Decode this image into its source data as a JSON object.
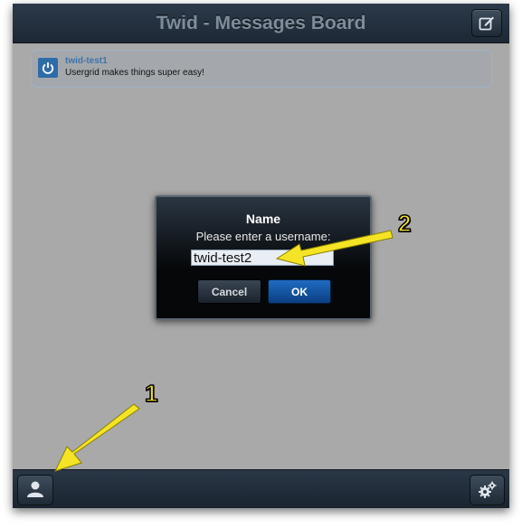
{
  "header": {
    "title": "Twid - Messages Board",
    "compose_icon": "compose-icon"
  },
  "messages": [
    {
      "username": "twid-test1",
      "text": "Usergrid makes things super easy!",
      "icon": "power-icon"
    }
  ],
  "dialog": {
    "title": "Name",
    "prompt": "Please enter a username:",
    "input_value": "twid-test2",
    "cancel_label": "Cancel",
    "ok_label": "OK"
  },
  "footer": {
    "user_icon": "user-icon",
    "settings_icon": "gear-icon"
  },
  "annotations": {
    "label_1": "1",
    "label_2": "2",
    "arrow_color": "#f5e425"
  },
  "colors": {
    "bar": "#1d2835",
    "background": "#a9a9a9",
    "accent": "#1f6bc1",
    "username": "#3e74a8"
  }
}
